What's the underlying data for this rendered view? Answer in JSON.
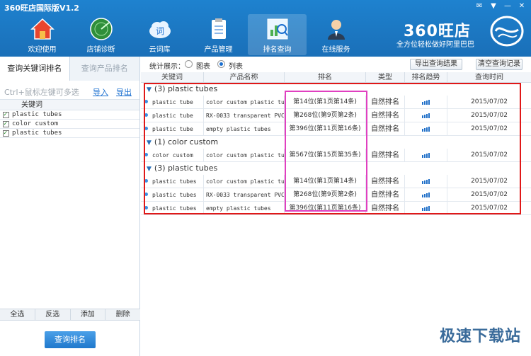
{
  "window": {
    "title": "360旺店国际版V1.2",
    "controls": [
      "✉",
      "▼",
      "—",
      "✕"
    ]
  },
  "nav": [
    {
      "label": "欢迎使用",
      "icon": "home-icon"
    },
    {
      "label": "店铺诊断",
      "icon": "radar-icon"
    },
    {
      "label": "云词库",
      "icon": "cloud-icon"
    },
    {
      "label": "产品管理",
      "icon": "clipboard-icon"
    },
    {
      "label": "排名查询",
      "icon": "chart-search-icon",
      "active": true
    },
    {
      "label": "在线服务",
      "icon": "support-agent-icon"
    }
  ],
  "brand": {
    "name": "360旺店",
    "slogan": "全方位轻松做好阿里巴巴"
  },
  "left": {
    "tabs": [
      "查询关键词排名",
      "查询产品排名"
    ],
    "hint": "Ctrl+鼠标左键可多选",
    "import_label": "导入",
    "export_label": "导出",
    "column_header": "关键词",
    "keywords": [
      "plastic  tubes",
      "color custom",
      "plastic tubes"
    ],
    "bottom_buttons": [
      "全选",
      "反选",
      "添加",
      "删除"
    ],
    "query_button": "查询排名"
  },
  "right": {
    "stats_label": "统计展示：",
    "radio_chart": "图表",
    "radio_list": "列表",
    "export_button": "导出查询结果",
    "clear_button": "清空查询记录",
    "columns": [
      "关键词",
      "产品名称",
      "排名",
      "类型",
      "排名趋势",
      "查询时间"
    ],
    "groups": [
      {
        "title": "(3)  plastic  tubes",
        "rows": [
          {
            "kw": "plastic  tube",
            "product": "color custom plastic tub",
            "rank": "第14位(第1页第14条)",
            "type": "自然排名",
            "date": "2015/07/02"
          },
          {
            "kw": "plastic  tube",
            "product": "RX-0033 transparent PVC",
            "rank": "第268位(第9页第2条)",
            "type": "自然排名",
            "date": "2015/07/02"
          },
          {
            "kw": "plastic  tube",
            "product": "empty plastic tubes",
            "rank": "第396位(第11页第16条)",
            "type": "自然排名",
            "date": "2015/07/02"
          }
        ]
      },
      {
        "title": "(1)  color custom",
        "rows": [
          {
            "kw": "color custom",
            "product": "color custom plastic tub",
            "rank": "第567位(第15页第35条)",
            "type": "自然排名",
            "date": "2015/07/02"
          }
        ]
      },
      {
        "title": "(3)  plastic tubes",
        "rows": [
          {
            "kw": "plastic tubes",
            "product": "color custom plastic tub",
            "rank": "第14位(第1页第14条)",
            "type": "自然排名",
            "date": "2015/07/02"
          },
          {
            "kw": "plastic tubes",
            "product": "RX-0033 transparent PVC",
            "rank": "第268位(第9页第2条)",
            "type": "自然排名",
            "date": "2015/07/02"
          },
          {
            "kw": "plastic tubes",
            "product": "empty plastic tubes",
            "rank": "第396位(第11页第16条)",
            "type": "自然排名",
            "date": "2015/07/02"
          }
        ]
      }
    ]
  },
  "watermark": "极速下载站",
  "colors": {
    "header": "#1e82cf",
    "accent": "#1a6fd0",
    "highlight_red": "#e01818",
    "highlight_pink": "#e040c0"
  }
}
